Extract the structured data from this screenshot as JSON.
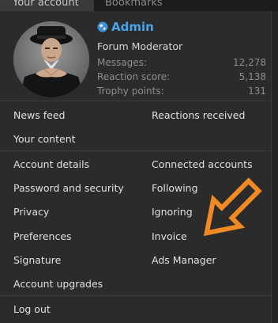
{
  "tabs": {
    "your_account": "Your account",
    "bookmarks": "Bookmarks"
  },
  "profile": {
    "name": "Admin",
    "title": "Forum Moderator",
    "stats": [
      {
        "label": "Messages:",
        "value": "12,278"
      },
      {
        "label": "Reaction score:",
        "value": "5,138"
      },
      {
        "label": "Trophy points:",
        "value": "131"
      }
    ]
  },
  "menu": {
    "news_feed": "News feed",
    "reactions_received": "Reactions received",
    "your_content": "Your content",
    "account_details": "Account details",
    "connected_accounts": "Connected accounts",
    "password_security": "Password and security",
    "following": "Following",
    "privacy": "Privacy",
    "ignoring": "Ignoring",
    "preferences": "Preferences",
    "invoice": "Invoice",
    "signature": "Signature",
    "ads_manager": "Ads Manager",
    "account_upgrades": "Account upgrades",
    "log_out": "Log out"
  },
  "colors": {
    "username": "#4aa3e8",
    "arrow": "#f08a24"
  }
}
